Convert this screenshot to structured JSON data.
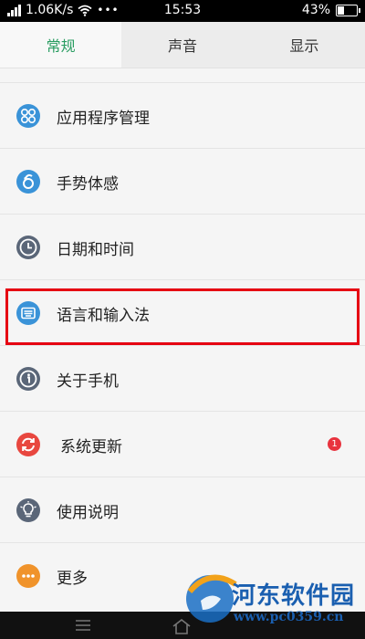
{
  "status_bar": {
    "net_speed": "1.06K/s",
    "time": "15:53",
    "battery_percent": "43%",
    "battery_level": 0.43
  },
  "tabs": [
    {
      "label": "常规",
      "active": true
    },
    {
      "label": "声音",
      "active": false
    },
    {
      "label": "显示",
      "active": false
    }
  ],
  "settings": [
    {
      "label": "应用程序管理",
      "icon": "apps-icon"
    },
    {
      "label": "手势体感",
      "icon": "gesture-icon"
    },
    {
      "label": "日期和时间",
      "icon": "clock-icon"
    },
    {
      "label": "语言和输入法",
      "icon": "keyboard-icon"
    },
    {
      "label": "关于手机",
      "icon": "info-icon"
    },
    {
      "label": "系统更新",
      "icon": "update-icon",
      "badge": "1"
    },
    {
      "label": "使用说明",
      "icon": "lightbulb-icon"
    },
    {
      "label": "更多",
      "icon": "more-icon"
    }
  ],
  "watermark": {
    "title": "河东软件园",
    "url": "www.pc0359.cn"
  },
  "colors": {
    "accent": "#2a9d62",
    "highlight": "#e60012",
    "badge": "#e8333e"
  }
}
